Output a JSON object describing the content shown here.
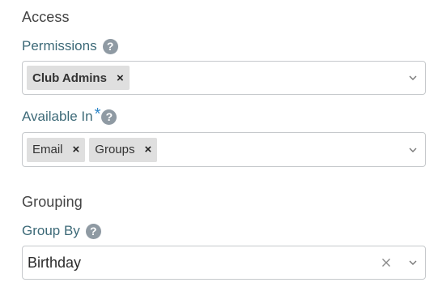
{
  "access": {
    "section_title": "Access",
    "permissions": {
      "label": "Permissions",
      "help_icon": "?",
      "tags": [
        {
          "label": "Club Admins",
          "remove": "×"
        }
      ]
    },
    "available_in": {
      "label": "Available In",
      "required_marker": "*",
      "help_icon": "?",
      "tags": [
        {
          "label": "Email",
          "remove": "×"
        },
        {
          "label": "Groups",
          "remove": "×"
        }
      ]
    }
  },
  "grouping": {
    "section_title": "Grouping",
    "group_by": {
      "label": "Group By",
      "help_icon": "?",
      "value": "Birthday"
    }
  },
  "colors": {
    "label_text": "#3d6a78",
    "required_marker": "#2f87c8",
    "help_icon_bg": "#8f9aa3",
    "tag_bg": "#dfdfdf",
    "border": "#c6c9cc"
  },
  "icons": {
    "help": "question-circle-icon",
    "dropdown": "chevron-down-icon",
    "clear": "clear-x-icon",
    "tag_remove": "remove-x-icon"
  }
}
